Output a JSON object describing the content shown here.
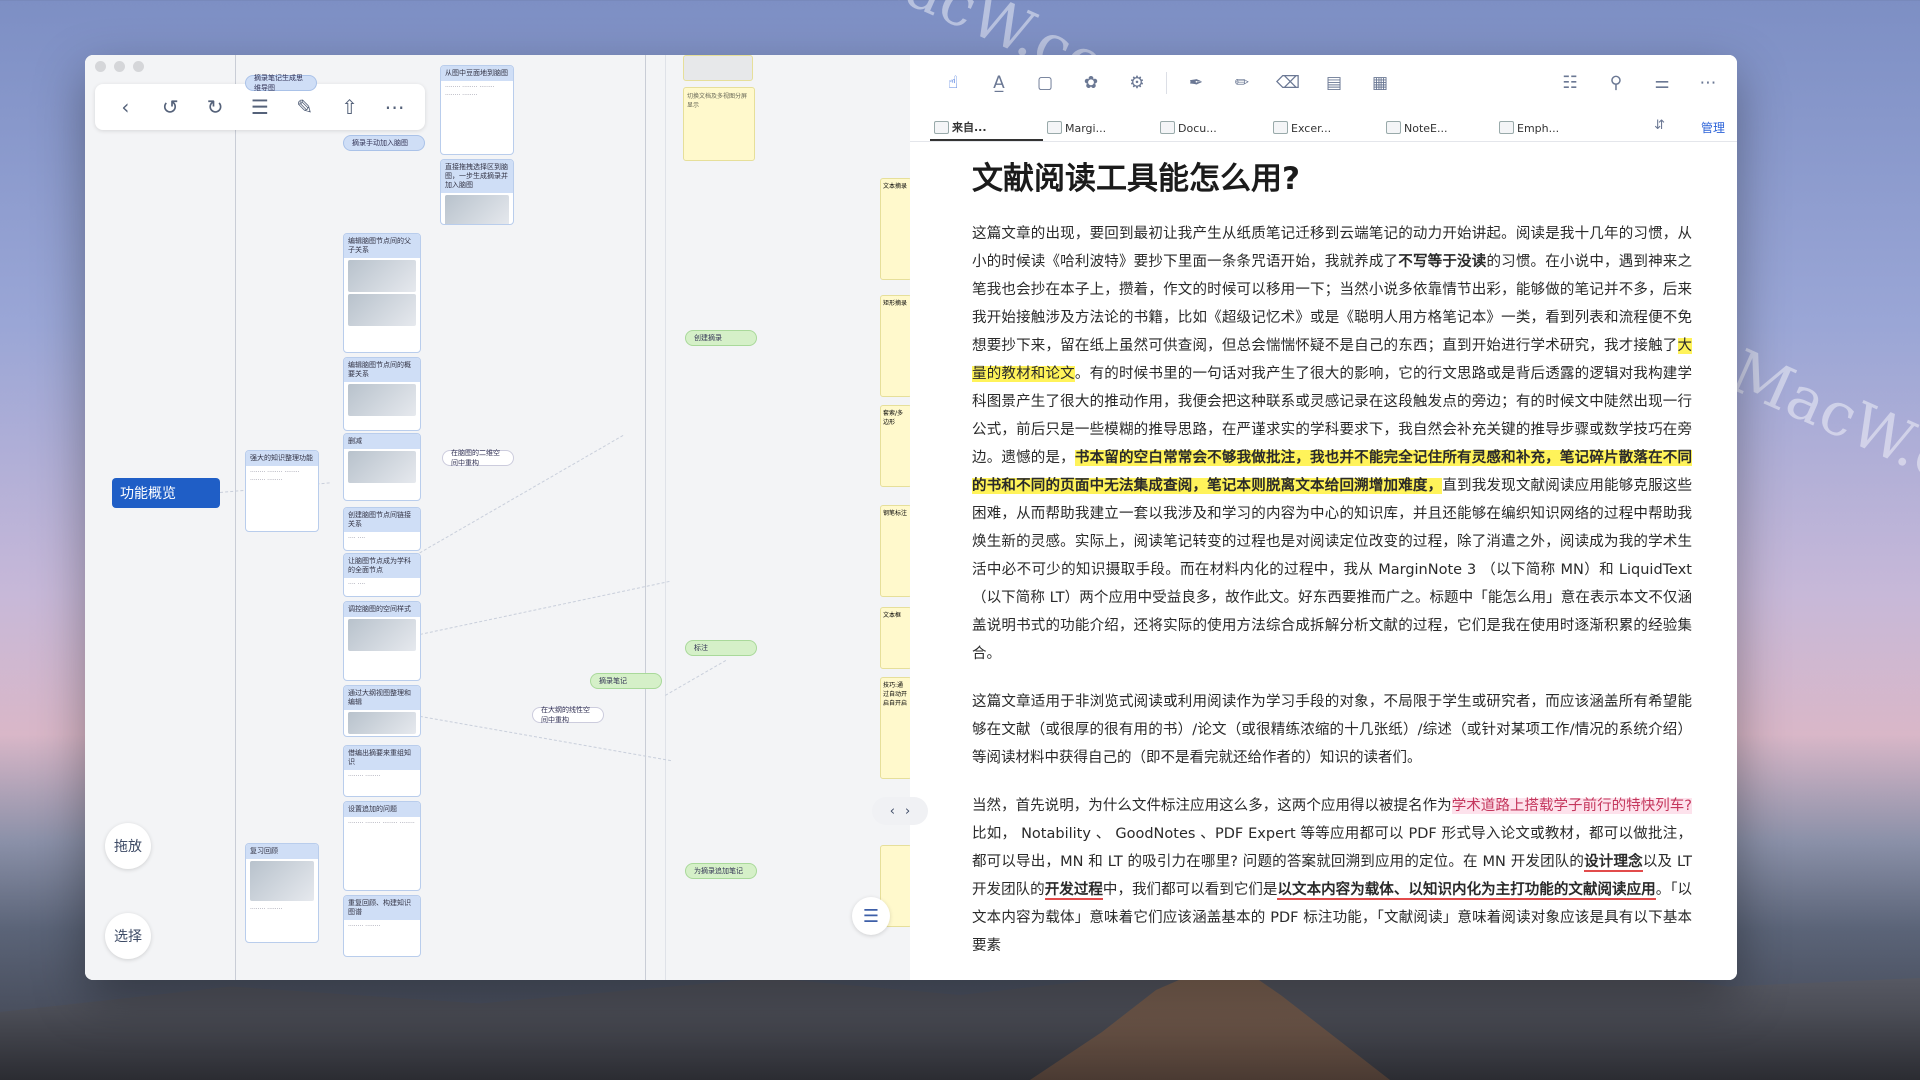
{
  "watermark": "MacW.com",
  "left_panel": {
    "root_label": "功能概览",
    "side_buttons": {
      "drag": "拖放",
      "select": "选择"
    },
    "nodes": {
      "n1": "摘录笔记生成思维导图",
      "n2": "从图中豆面地到脑图",
      "n3": "摘录手动加入脑图",
      "n4": "直接拖拽选择区到脑图，一步生成摘录并加入脑图",
      "n5": "编辑脑图节点间的父子关系",
      "n6": "编辑脑图节点间的概要关系",
      "n7": "删减",
      "n8": "强大的知识整理功能",
      "n9": "在脑图的二维空间中重构",
      "n10": "创建脑图节点间链接关系",
      "n11": "让脑图节点成为学科的全面节点",
      "n12": "调控脑图的空间样式",
      "n13": "通过大纲视图整理和编辑",
      "n14": "在大纲的线性空间中重构",
      "n15": "借编出摘要来重组知识",
      "n16": "设置追加的问题",
      "n17": "复习回顾",
      "n18": "重复回顾、构建知识图谱",
      "n19": "切换文档及多视图分屏显示",
      "n20": "创建摘录",
      "n21": "摘录笔记",
      "n22": "标注",
      "n23": "为摘录追加笔记",
      "n24": "文本摘录",
      "n25": "矩形摘录",
      "n26": "套索/多边形",
      "n27": "钢笔标注",
      "n28": "文本框",
      "n29": "技巧:通过自动开启自开启"
    }
  },
  "toolbar": {
    "icons": [
      "hand-pointer-icon",
      "text-highlight-icon",
      "rect-select-icon",
      "lasso-icon",
      "screenshot-icon",
      "pen-icon",
      "highlighter-icon",
      "eraser-icon",
      "textbox-icon",
      "ocr-icon"
    ],
    "right_icons": [
      "document-icon",
      "search-icon",
      "bookmark-icon",
      "more-icon"
    ]
  },
  "tabs": [
    {
      "label": "来自..."
    },
    {
      "label": "Margi..."
    },
    {
      "label": "Docu..."
    },
    {
      "label": "Excer..."
    },
    {
      "label": "NoteE..."
    },
    {
      "label": "Emph..."
    }
  ],
  "tabs_manage": "管理",
  "doc": {
    "title": "文献阅读工具能怎么用?",
    "p1_a": "这篇文章的出现，要回到最初让我产生从纸质笔记迁移到云端笔记的动力开始讲起。阅读是我十几年的习惯，从小的时候读《哈利波特》要抄下里面一条条咒语开始，我就养成了",
    "p1_b": "不写等于没读",
    "p1_c": "的习惯。在小说中，遇到神来之笔我也会抄在本子上，攒着，作文的时候可以移用一下；当然小说多依靠情节出彩，能够做的笔记并不多，后来我开始接触涉及方法论的书籍，比如《超级记忆术》或是《聪明人用方格笔记本》一类，看到列表和流程便不免想要抄下来，留在纸上虽然可供查阅，但总会惴惴怀疑不是自己的东西；直到开始进行学术研究，我才接触了",
    "p1_d": "大量的教材和论文",
    "p1_e": "。有的时候书里的一句话对我产生了很大的影响，它的行文思路或是背后透露的逻辑对我构建学科图景产生了很大的推动作用，我便会把这种联系或灵感记录在这段触发点的旁边；有的时候文中陡然出现一行公式，前后只是一些模糊的推导思路，在严谨求实的学科要求下，我自然会补充关键的推导步骤或数学技巧在旁边。遗憾的是，",
    "p1_f": "书本留的空白常常会不够我做批注，我也并不能完全记住所有灵感和补充，笔记碎片散落在不同的书和不同的页面中无法集成查阅，笔记本则脱离文本给回溯增加难度，",
    "p1_g": "直到我发现文献阅读应用能够克服这些困难，从而帮助我建立一套以我涉及和学习的内容为中心的知识库，并且还能够在编织知识网络的过程中帮助我焕生新的灵感。实际上，阅读笔记转变的过程也是对阅读定位改变的过程，除了消遣之外，阅读成为我的学术生活中必不可少的知识摄取手段。而在材料内化的过程中，我从 MarginNote 3 （以下简称 MN）和 LiquidText （以下简称 LT）两个应用中受益良多，故作此文。好东西要推而广之。标题中「能怎么用」意在表示本文不仅涵盖说明书式的功能介绍，还将实际的使用方法综合成拆解分析文献的过程，它们是我在使用时逐渐积累的经验集合。",
    "p2": "这篇文章适用于非浏览式阅读或利用阅读作为学习手段的对象，不局限于学生或研究者，而应该涵盖所有希望能够在文献（或很厚的很有用的书）/论文（或很精练浓缩的十几张纸）/综述（或针对某项工作/情况的系统介绍）等阅读材料中获得自己的（即不是看完就还给作者的）知识的读者们。",
    "p3_a": "当然，首先说明，为什么文件标注应用这么多，这两个应用得以被提名作为",
    "p3_b": "学术道路上搭载学子前行的特快列车?",
    "p3_c": "比如， Notability 、 GoodNotes 、PDF Expert 等等应用都可以 PDF 形式导入论文或教材，都可以做批注，都可以导出，MN 和 LT 的吸引力在哪里? 问题的答案就回溯到应用的定位。在 MN 开发团队的",
    "p3_d": "设计理念",
    "p3_e": "以及 LT 开发团队的",
    "p3_f": "开发过程",
    "p3_g": "中，我们都可以看到它们是",
    "p3_h": "以文本内容为载体、以知识内化为主打功能的文献阅读应用",
    "p3_i": "。「以文本内容为载体」意味着它们应该涵盖基本的 PDF 标注功能，「文献阅读」意味着阅读对象应该是具有以下基本要素"
  }
}
